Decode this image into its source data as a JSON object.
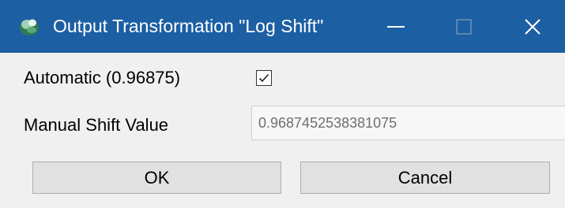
{
  "window": {
    "title": "Output Transformation \"Log Shift\"",
    "titlebar_color": "#1c5fa3",
    "icon": "app-icon",
    "controls": [
      "minimize-icon",
      "maximize-icon",
      "close-icon"
    ]
  },
  "automatic": {
    "label": "Automatic (0.96875)",
    "checked": true
  },
  "manual": {
    "label": "Manual Shift Value",
    "value": "0.9687452538381075",
    "disabled": true
  },
  "buttons": {
    "ok_label": "OK",
    "cancel_label": "Cancel"
  }
}
